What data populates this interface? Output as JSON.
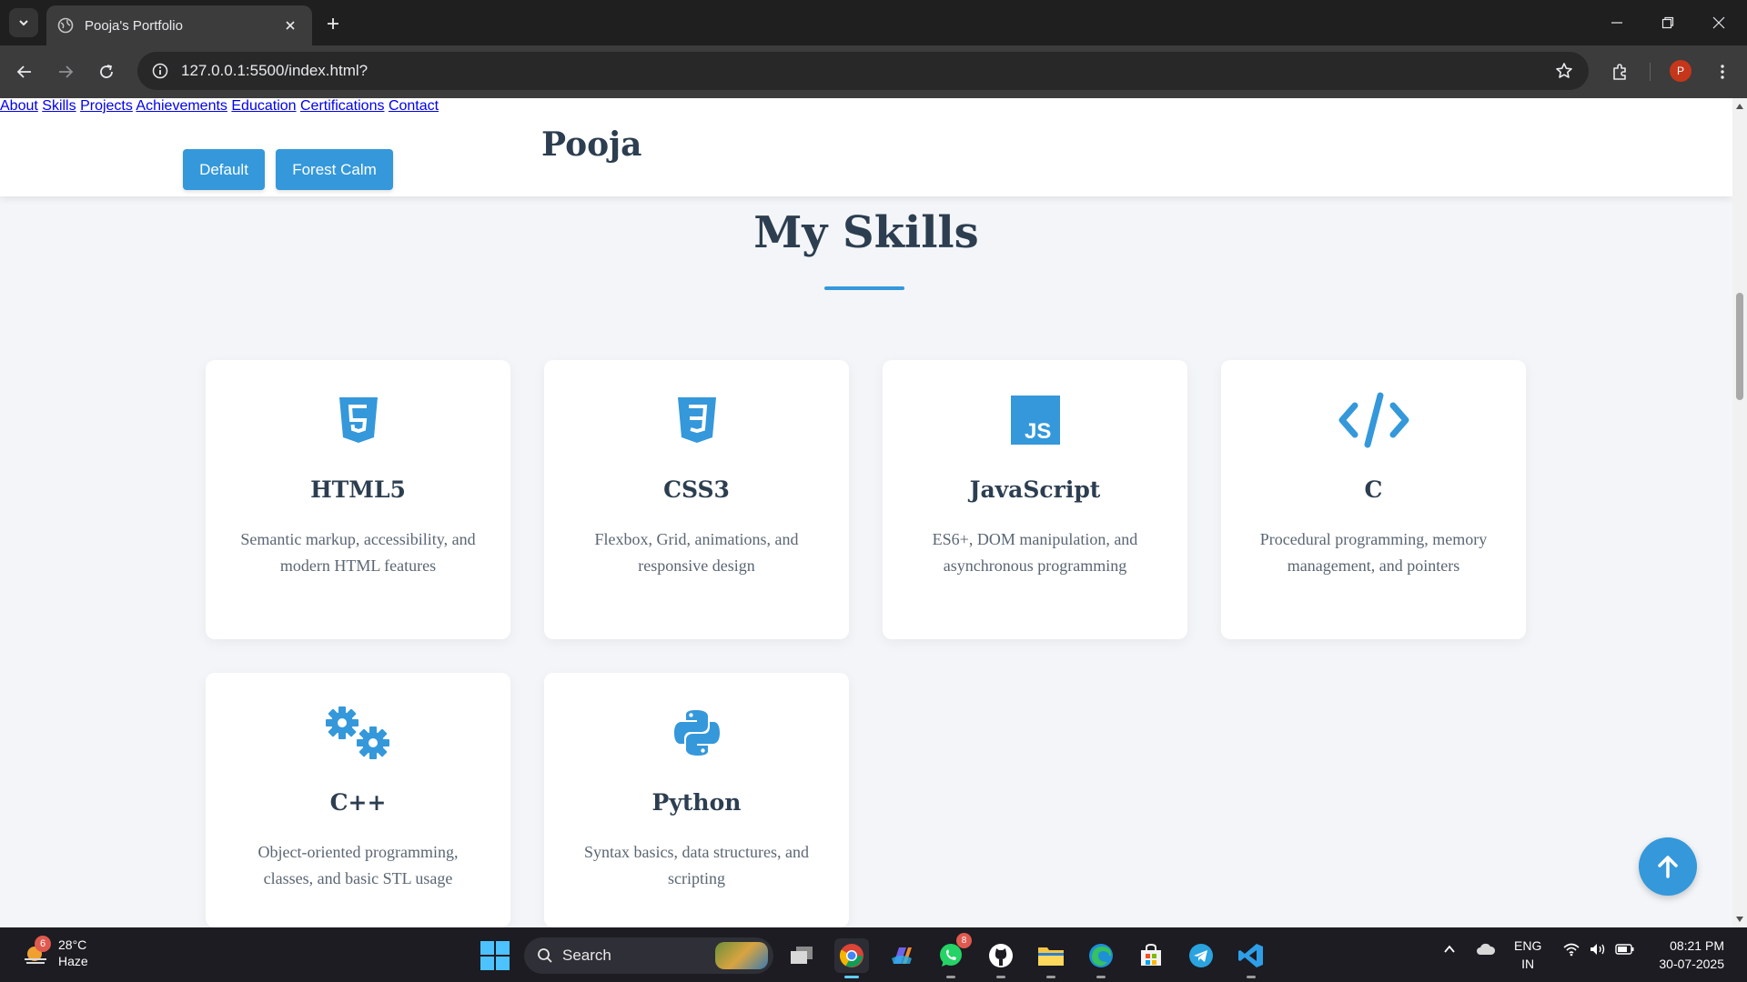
{
  "browser": {
    "tab_title": "Pooja's Portfolio",
    "url": "127.0.0.1:5500/index.html?",
    "profile_initial": "P"
  },
  "header": {
    "theme_buttons": [
      "Default",
      "Forest Calm"
    ],
    "brand": "Pooja",
    "nav": [
      "About",
      "Skills",
      "Projects",
      "Achievements",
      "Education",
      "Certifications",
      "Contact"
    ]
  },
  "section": {
    "title": "My Skills"
  },
  "skills": [
    {
      "icon": "html5-icon",
      "title": "HTML5",
      "desc": "Semantic markup, accessibility, and modern HTML features"
    },
    {
      "icon": "css3-icon",
      "title": "CSS3",
      "desc": "Flexbox, Grid, animations, and responsive design"
    },
    {
      "icon": "javascript-icon",
      "title": "JavaScript",
      "desc": "ES6+, DOM manipulation, and asynchronous programming"
    },
    {
      "icon": "code-icon",
      "title": "C",
      "desc": "Procedural programming, memory management, and pointers"
    },
    {
      "icon": "gears-icon",
      "title": "C++",
      "desc": "Object-oriented programming, classes, and basic STL usage"
    },
    {
      "icon": "python-icon",
      "title": "Python",
      "desc": "Syntax basics, data structures, and scripting"
    }
  ],
  "colors": {
    "accent": "#3498db",
    "heading": "#2c3e50",
    "page_bg": "#f3f5f8"
  },
  "taskbar": {
    "weather_temp": "28°C",
    "weather_desc": "Haze",
    "weather_badge": "6",
    "search_label": "Search",
    "whatsapp_badge": "8",
    "lang_line1": "ENG",
    "lang_line2": "IN",
    "time": "08:21 PM",
    "date": "30-07-2025"
  }
}
